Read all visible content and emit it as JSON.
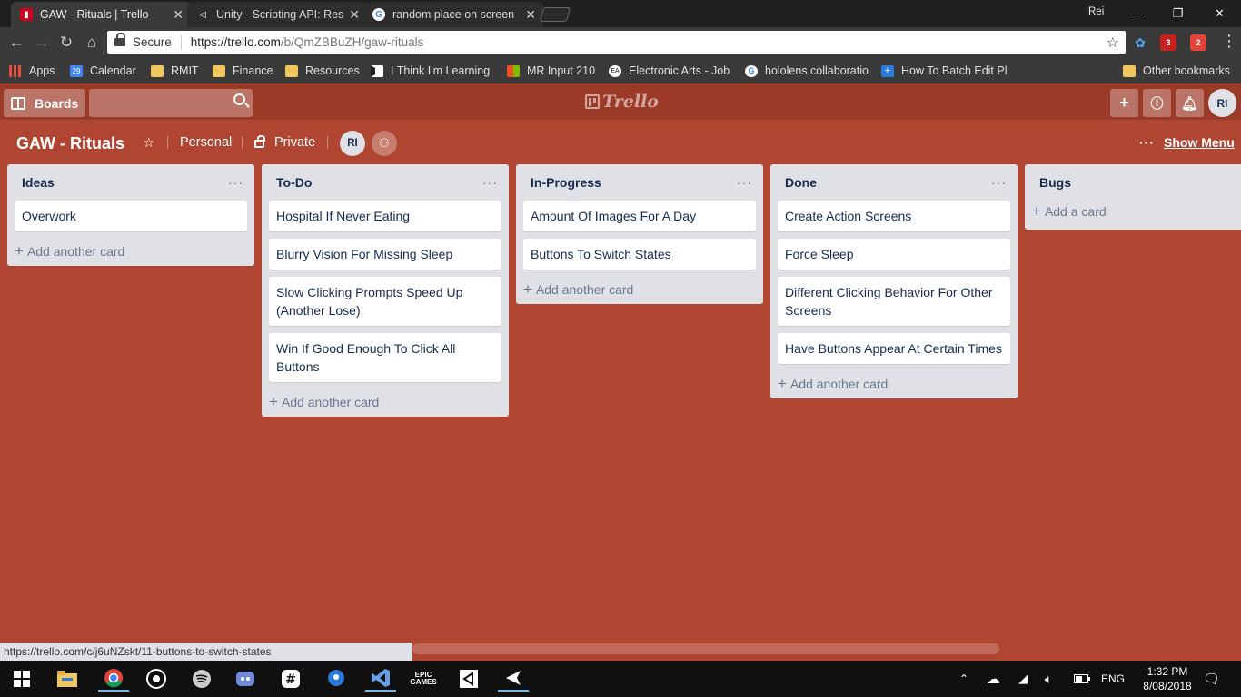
{
  "browser": {
    "tabs": [
      {
        "title": "GAW - Rituals | Trello",
        "active": true,
        "favicon": "trello-icon",
        "color": "#d0021b"
      },
      {
        "title": "Unity - Scripting API: Res",
        "active": false,
        "favicon": "unity-icon",
        "color": "#ffffff"
      },
      {
        "title": "random place on screen",
        "active": false,
        "favicon": "google-icon",
        "color": "#4285f4"
      }
    ],
    "profile_name": "Rei",
    "secure_label": "Secure",
    "url_host": "https://trello.com",
    "url_path": "/b/QmZBBuZH/gaw-rituals",
    "extension_badges": {
      "gmail": "3",
      "other": "2"
    },
    "bookmarks": [
      {
        "label": "Apps",
        "icon": "apps-grid-icon"
      },
      {
        "label": "Calendar",
        "icon": "calendar-icon",
        "badge": "29"
      },
      {
        "label": "RMIT",
        "icon": "folder-icon"
      },
      {
        "label": "Finance",
        "icon": "folder-icon"
      },
      {
        "label": "Resources",
        "icon": "folder-icon"
      },
      {
        "label": "I Think I'm Learning",
        "icon": "trello-icon"
      },
      {
        "label": "MR Input 210",
        "icon": "windows-icon"
      },
      {
        "label": "Electronic Arts - Job",
        "icon": "ea-icon"
      },
      {
        "label": "hololens collaboratio",
        "icon": "google-icon"
      },
      {
        "label": "How To Batch Edit Pl",
        "icon": "plus-icon"
      },
      {
        "label": "Other bookmarks",
        "icon": "folder-icon"
      }
    ]
  },
  "trello": {
    "boards_label": "Boards",
    "logo_text": "Trello",
    "user_initials": "RI"
  },
  "board": {
    "title": "GAW - Rituals",
    "team": "Personal",
    "visibility": "Private",
    "member_initials": "RI",
    "show_menu_label": "Show Menu",
    "background_color": "#b04632"
  },
  "lists": [
    {
      "title": "Ideas",
      "cards": [
        "Overwork"
      ],
      "add_label": "Add another card"
    },
    {
      "title": "To-Do",
      "cards": [
        "Hospital If Never Eating",
        "Blurry Vision For Missing Sleep",
        "Slow Clicking Prompts Speed Up (Another Lose)",
        "Win If Good Enough To Click All Buttons"
      ],
      "add_label": "Add another card"
    },
    {
      "title": "In-Progress",
      "cards": [
        "Amount Of Images For A Day",
        "Buttons To Switch States"
      ],
      "add_label": "Add another card"
    },
    {
      "title": "Done",
      "cards": [
        "Create Action Screens",
        "Force Sleep",
        "Different Clicking Behavior For Other Screens",
        "Have Buttons Appear At Certain Times"
      ],
      "add_label": "Add another card"
    },
    {
      "title": "Bugs",
      "cards": [],
      "add_label": "Add a card"
    }
  ],
  "status_url": "https://trello.com/c/j6uNZskt/11-buttons-to-switch-states",
  "taskbar": {
    "language": "ENG",
    "time": "1:32 PM",
    "date": "8/08/2018",
    "epic_label": "EPIC GAMES"
  }
}
